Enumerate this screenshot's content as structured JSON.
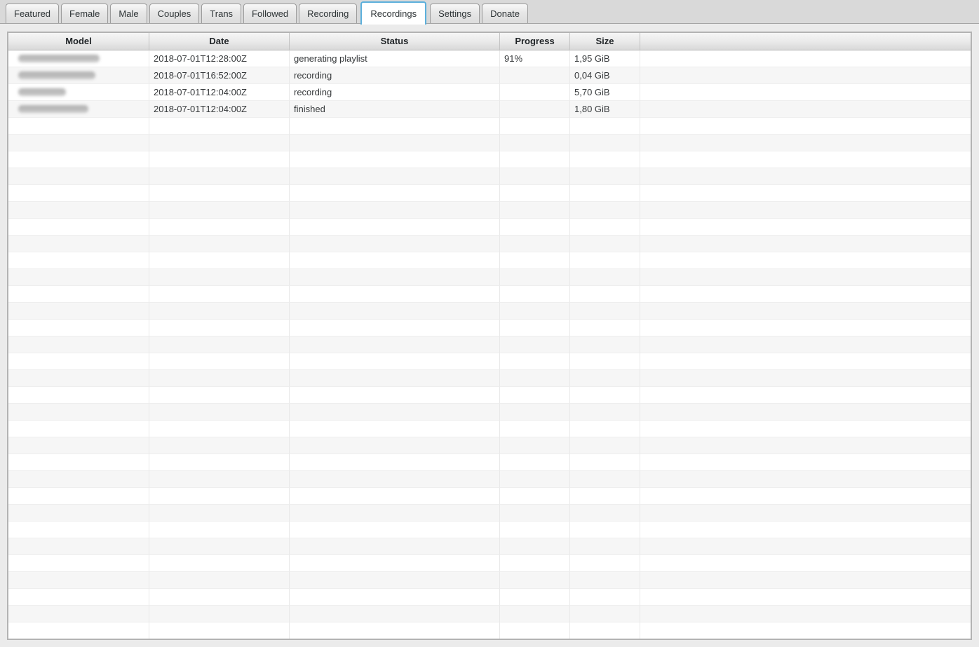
{
  "tabs": [
    {
      "id": "featured",
      "label": "Featured",
      "active": false
    },
    {
      "id": "female",
      "label": "Female",
      "active": false
    },
    {
      "id": "male",
      "label": "Male",
      "active": false
    },
    {
      "id": "couples",
      "label": "Couples",
      "active": false
    },
    {
      "id": "trans",
      "label": "Trans",
      "active": false
    },
    {
      "id": "followed",
      "label": "Followed",
      "active": false
    },
    {
      "id": "recording",
      "label": "Recording",
      "active": false
    },
    {
      "id": "recordings",
      "label": "Recordings",
      "active": true
    },
    {
      "id": "settings",
      "label": "Settings",
      "active": false
    },
    {
      "id": "donate",
      "label": "Donate",
      "active": false
    }
  ],
  "colors": {
    "active_tab_border": "#5cb0dc",
    "tabbar_background": "#d9d9d9",
    "row_stripe": "#f6f6f6"
  },
  "table": {
    "columns": [
      {
        "id": "model",
        "label": "Model"
      },
      {
        "id": "date",
        "label": "Date"
      },
      {
        "id": "status",
        "label": "Status"
      },
      {
        "id": "progress",
        "label": "Progress"
      },
      {
        "id": "size",
        "label": "Size"
      },
      {
        "id": "spacer",
        "label": ""
      }
    ],
    "rows": [
      {
        "model_censored": true,
        "model_blob_width": 116,
        "date": "2018-07-01T12:28:00Z",
        "status": "generating playlist",
        "progress": "91%",
        "size": "1,95 GiB"
      },
      {
        "model_censored": true,
        "model_blob_width": 110,
        "date": "2018-07-01T16:52:00Z",
        "status": "recording",
        "progress": "",
        "size": "0,04 GiB"
      },
      {
        "model_censored": true,
        "model_blob_width": 68,
        "date": "2018-07-01T12:04:00Z",
        "status": "recording",
        "progress": "",
        "size": "5,70 GiB"
      },
      {
        "model_censored": true,
        "model_blob_width": 100,
        "date": "2018-07-01T12:04:00Z",
        "status": "finished",
        "progress": "",
        "size": "1,80 GiB"
      }
    ],
    "empty_row_count": 31
  }
}
